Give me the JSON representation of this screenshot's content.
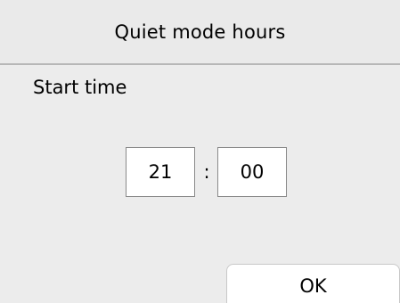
{
  "header": {
    "title": "Quiet mode hours"
  },
  "main": {
    "subheading": "Start time",
    "time": {
      "hours": "21",
      "separator": ":",
      "minutes": "00"
    }
  },
  "footer": {
    "ok_label": "OK"
  }
}
